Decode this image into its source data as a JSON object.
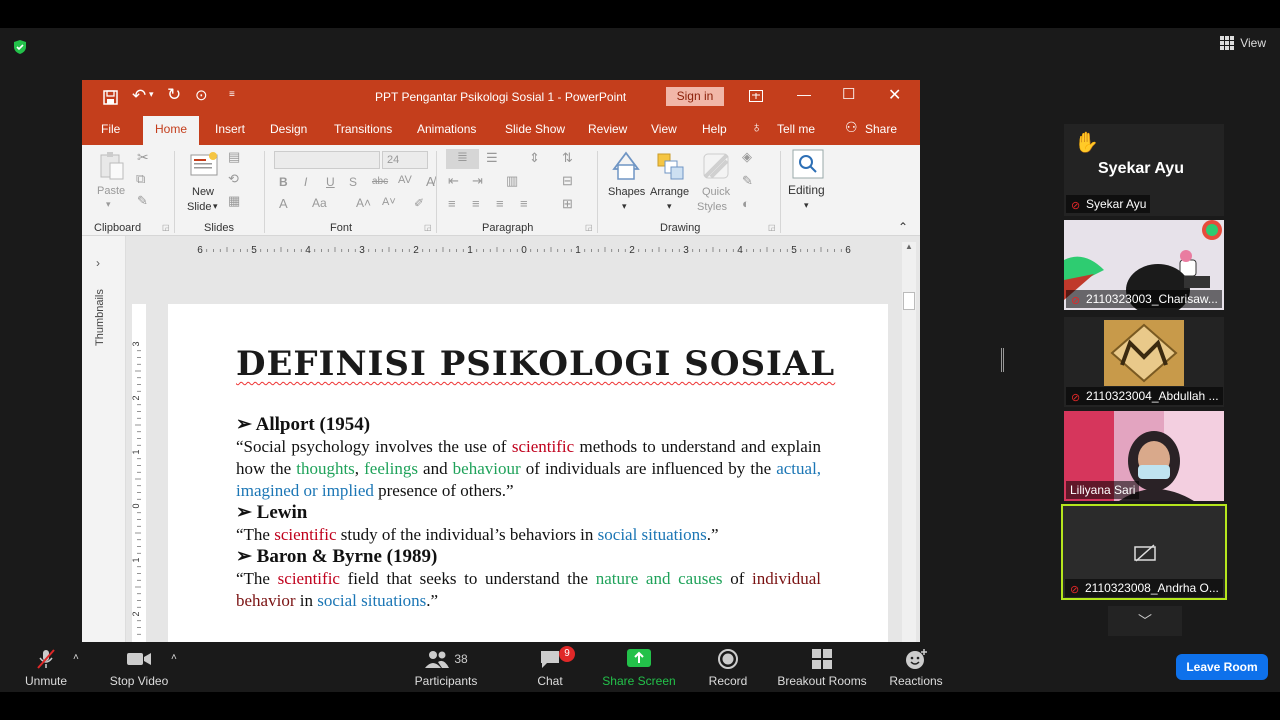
{
  "zoom": {
    "view_label": "View",
    "bottom": {
      "unmute": "Unmute",
      "stop_video": "Stop Video",
      "participants": "Participants",
      "participants_count": "38",
      "chat": "Chat",
      "chat_badge": "9",
      "share_screen": "Share Screen",
      "record": "Record",
      "breakout_rooms": "Breakout Rooms",
      "reactions": "Reactions",
      "leave_room": "Leave Room"
    },
    "speaker": {
      "name": "Syekar Ayu",
      "tag": "Syekar Ayu"
    },
    "tiles": [
      {
        "name": "2110323003_Charisaw..."
      },
      {
        "name": "2110323004_Abdullah ..."
      },
      {
        "name": "Liliyana Sari"
      },
      {
        "name": "2110323008_Andrha O..."
      }
    ],
    "colors": {
      "leave": "#0e71eb",
      "active_border": "#b5e61d",
      "ppt_accent": "#c43e1c"
    }
  },
  "ppt": {
    "window_title": "PPT Pengantar Psikologi Sosial 1  -  PowerPoint",
    "sign_in": "Sign in",
    "tabs": [
      "File",
      "Home",
      "Insert",
      "Design",
      "Transitions",
      "Animations",
      "Slide Show",
      "Review",
      "View",
      "Help"
    ],
    "tell_me": "Tell me",
    "share": "Share",
    "ribbon": {
      "paste": "Paste",
      "new_slide_1": "New",
      "new_slide_2": "Slide",
      "font_size": "24",
      "shapes": "Shapes",
      "arrange": "Arrange",
      "quick_1": "Quick",
      "quick_2": "Styles",
      "editing": "Editing",
      "groups": [
        "Clipboard",
        "Slides",
        "Font",
        "Paragraph",
        "Drawing"
      ]
    },
    "thumbnails_label": "Thumbnails",
    "hruler_labels": [
      "6",
      "5",
      "4",
      "3",
      "2",
      "1",
      "0",
      "1",
      "2",
      "3",
      "4",
      "5",
      "6"
    ],
    "vruler_labels": [
      "3",
      "2",
      "1",
      "0",
      "1",
      "2"
    ],
    "slide": {
      "title": "DEFINISI PSIKOLOGI SOSIAL",
      "h1": "Allport (1954)",
      "q1": {
        "a": "“Social psychology involves the use of ",
        "b": "scientific",
        "c": " methods to understand and explain how the ",
        "d": "thoughts",
        "e": ", ",
        "f": "feelings",
        "g": " and ",
        "h": "behaviour",
        "i": " of individuals are influenced by the ",
        "j": "actual, imagined or implied",
        "k": " presence of others.”"
      },
      "h2": "Lewin",
      "q2": {
        "a": "“The ",
        "b": "scientific",
        "c": " study of the individual’s behaviors in ",
        "d": "social situations",
        "e": ".”"
      },
      "h3": "Baron & Byrne (1989)",
      "q3": {
        "a": "“The ",
        "b": "scientific",
        "c": " field that seeks to understand the ",
        "d": "nature and causes",
        "e": " of ",
        "f": "individual behavior",
        "g": " in ",
        "h": "social situations",
        "i": ".”"
      }
    }
  }
}
